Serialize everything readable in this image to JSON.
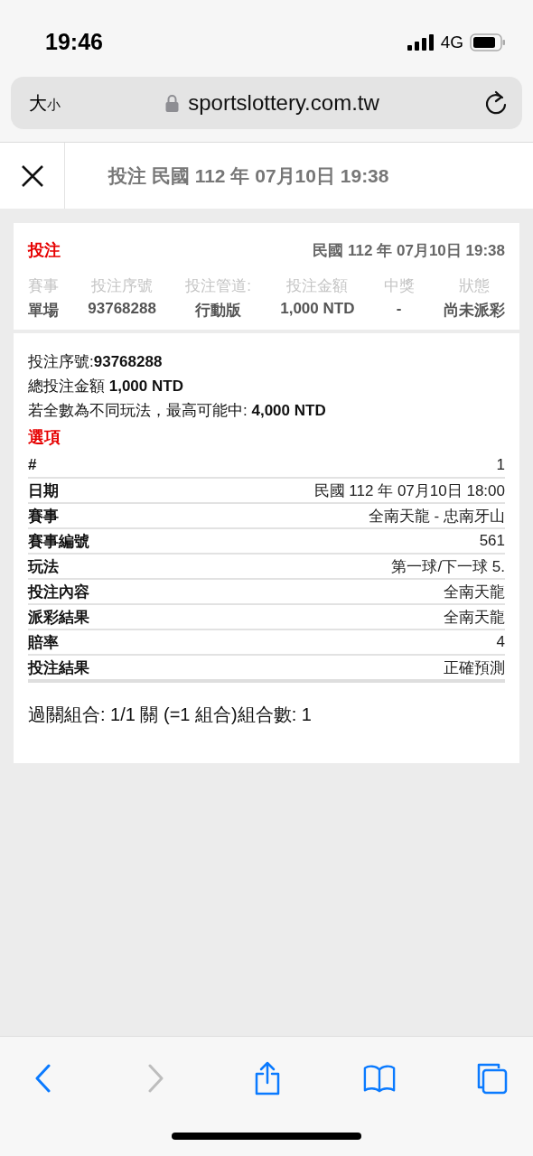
{
  "status_bar": {
    "time": "19:46",
    "network": "4G"
  },
  "address_bar": {
    "text_size_large": "大",
    "text_size_small": "小",
    "url": "sportslottery.com.tw"
  },
  "header": {
    "title": "投注 民國 112 年 07月10日 19:38"
  },
  "summary": {
    "heading": "投注",
    "date": "民國 112 年 07月10日 19:38",
    "columns": [
      {
        "label": "賽事",
        "value": "單場"
      },
      {
        "label": "投注序號",
        "value": "93768288"
      },
      {
        "label": "投注管道:",
        "value": "行動版"
      },
      {
        "label": "投注金額",
        "value": "1,000 NTD"
      },
      {
        "label": "中獎",
        "value": "-"
      },
      {
        "label": "狀態",
        "value": "尚未派彩"
      }
    ]
  },
  "details": {
    "lines": [
      "投注序號:**93768288**",
      "總投注金額 **1,000 NTD**",
      "若全數為不同玩法，最高可能中: **4,000 NTD**"
    ],
    "options_heading": "選項",
    "rows": [
      {
        "label": "#",
        "value": "1"
      },
      {
        "label": "日期",
        "value": "民國 112 年 07月10日 18:00"
      },
      {
        "label": "賽事",
        "value": "全南天龍 - 忠南牙山"
      },
      {
        "label": "賽事編號",
        "value": "561"
      },
      {
        "label": "玩法",
        "value": "第一球/下一球 5."
      },
      {
        "label": "投注內容",
        "value": "全南天龍"
      },
      {
        "label": "派彩結果",
        "value": "全南天龍"
      },
      {
        "label": "賠率",
        "value": "4"
      },
      {
        "label": "投注結果",
        "value": "正確預測"
      }
    ],
    "combination": "過關組合: 1/1 關 (=1 組合)組合數: 1"
  },
  "toolbar": {
    "buttons": [
      {
        "kind": "back",
        "disabled": false
      },
      {
        "kind": "forward",
        "disabled": true
      },
      {
        "kind": "share",
        "disabled": false
      },
      {
        "kind": "bookmarks",
        "disabled": false
      },
      {
        "kind": "tabs",
        "disabled": false
      }
    ]
  }
}
